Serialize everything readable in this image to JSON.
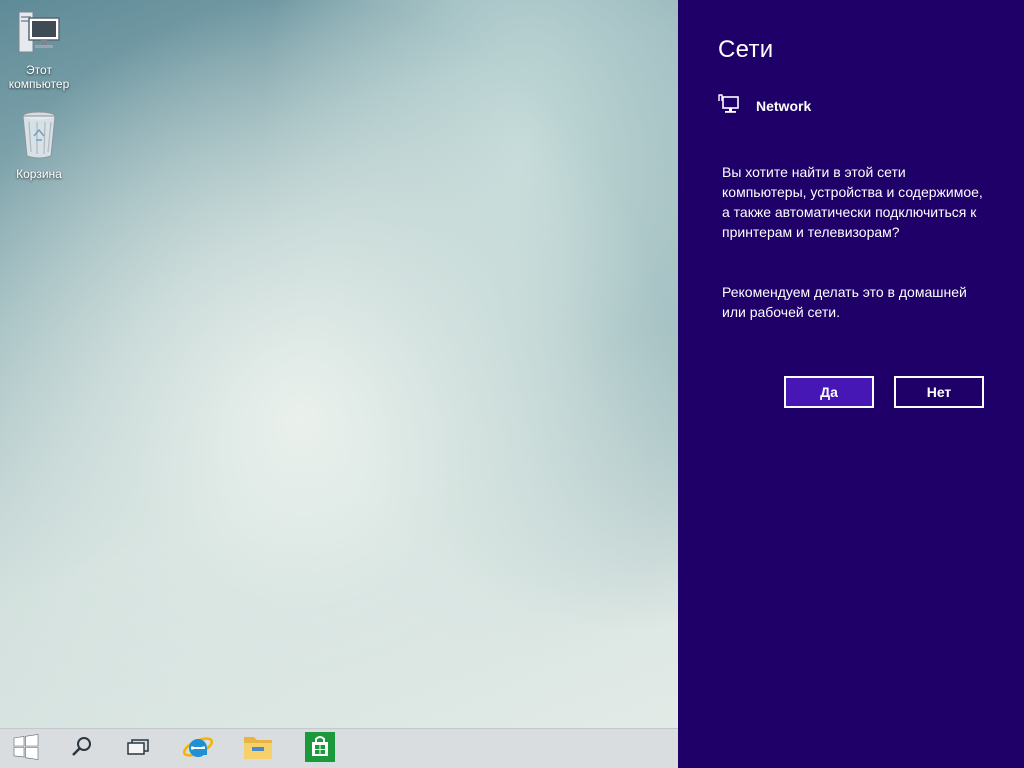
{
  "desktop": {
    "icons": [
      {
        "label_line1": "Этот",
        "label_line2": "компьютер",
        "icon": "this-pc-icon"
      },
      {
        "label": "Корзина",
        "icon": "recycle-bin-icon"
      }
    ]
  },
  "taskbar": {
    "items": [
      {
        "icon": "windows-start-icon"
      },
      {
        "icon": "search-icon"
      },
      {
        "icon": "task-view-icon"
      },
      {
        "icon": "internet-explorer-icon"
      },
      {
        "icon": "file-explorer-icon"
      },
      {
        "icon": "store-icon"
      }
    ]
  },
  "charm": {
    "title": "Сети",
    "network_name": "Network",
    "network_icon": "network-monitor-icon",
    "question": "Вы хотите найти в этой сети компьютеры, устройства и содержимое, а также автоматически подключиться к принтерам и телевизорам?",
    "recommendation": "Рекомендуем делать это в домашней или рабочей сети.",
    "yes_label": "Да",
    "no_label": "Нет"
  },
  "colors": {
    "charm_bg": "#1f0068",
    "yes_button_bg": "#4617b4",
    "taskbar_bg": "#d9dde0"
  }
}
